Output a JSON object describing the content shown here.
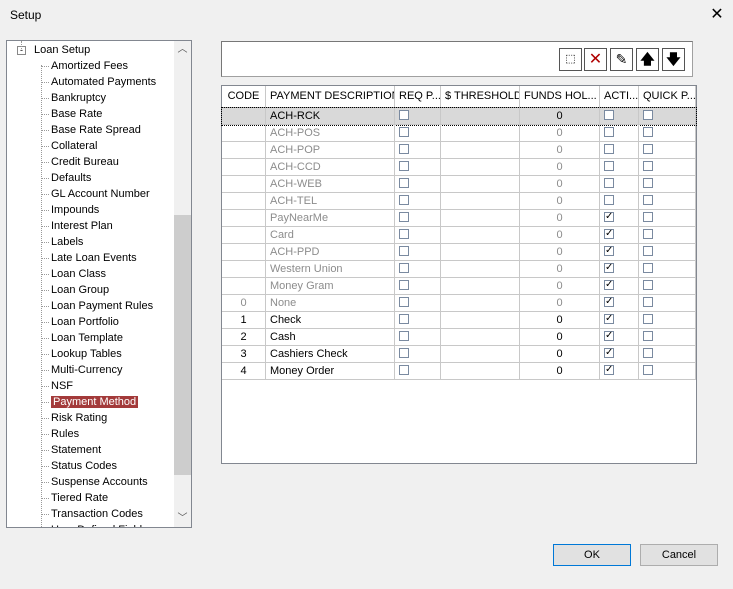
{
  "window": {
    "title": "Setup",
    "close_icon": "close-icon"
  },
  "tree": {
    "root": "Loan Setup",
    "selected": "Payment Method",
    "items": [
      "Amortized Fees",
      "Automated Payments",
      "Bankruptcy",
      "Base Rate",
      "Base Rate Spread",
      "Collateral",
      "Credit Bureau",
      "Defaults",
      "GL Account Number",
      "Impounds",
      "Interest Plan",
      "Labels",
      "Late Loan Events",
      "Loan Class",
      "Loan Group",
      "Loan Payment Rules",
      "Loan Portfolio",
      "Loan Template",
      "Lookup Tables",
      "Multi-Currency",
      "NSF",
      "Payment Method",
      "Risk Rating",
      "Rules",
      "Statement",
      "Status Codes",
      "Suspense Accounts",
      "Tiered Rate",
      "Transaction Codes",
      "User Defined Fields"
    ]
  },
  "toolbar": {
    "buttons": [
      "new-icon",
      "delete-icon",
      "edit-icon",
      "move-up-icon",
      "move-down-icon"
    ]
  },
  "grid": {
    "columns": [
      "CODE",
      "PAYMENT DESCRIPTION",
      "REQ P...",
      "$ THRESHOLD",
      "FUNDS HOL...",
      "ACTI...",
      "QUICK P..."
    ],
    "rows": [
      {
        "code": "",
        "desc": "ACH-RCK",
        "req": false,
        "threshold": "",
        "funds": "0",
        "active": false,
        "quick": false,
        "gray": false,
        "selected": true
      },
      {
        "code": "",
        "desc": "ACH-POS",
        "req": false,
        "threshold": "",
        "funds": "0",
        "active": false,
        "quick": false,
        "gray": true
      },
      {
        "code": "",
        "desc": "ACH-POP",
        "req": false,
        "threshold": "",
        "funds": "0",
        "active": false,
        "quick": false,
        "gray": true
      },
      {
        "code": "",
        "desc": "ACH-CCD",
        "req": false,
        "threshold": "",
        "funds": "0",
        "active": false,
        "quick": false,
        "gray": true
      },
      {
        "code": "",
        "desc": "ACH-WEB",
        "req": false,
        "threshold": "",
        "funds": "0",
        "active": false,
        "quick": false,
        "gray": true
      },
      {
        "code": "",
        "desc": "ACH-TEL",
        "req": false,
        "threshold": "",
        "funds": "0",
        "active": false,
        "quick": false,
        "gray": true
      },
      {
        "code": "",
        "desc": "PayNearMe",
        "req": false,
        "threshold": "",
        "funds": "0",
        "active": true,
        "quick": false,
        "gray": true
      },
      {
        "code": "",
        "desc": "Card",
        "req": false,
        "threshold": "",
        "funds": "0",
        "active": true,
        "quick": false,
        "gray": true
      },
      {
        "code": "",
        "desc": "ACH-PPD",
        "req": false,
        "threshold": "",
        "funds": "0",
        "active": true,
        "quick": false,
        "gray": true
      },
      {
        "code": "",
        "desc": "Western Union",
        "req": false,
        "threshold": "",
        "funds": "0",
        "active": true,
        "quick": false,
        "gray": true
      },
      {
        "code": "",
        "desc": "Money Gram",
        "req": false,
        "threshold": "",
        "funds": "0",
        "active": true,
        "quick": false,
        "gray": true
      },
      {
        "code": "0",
        "desc": "None",
        "req": false,
        "threshold": "",
        "funds": "0",
        "active": true,
        "quick": false,
        "gray": true
      },
      {
        "code": "1",
        "desc": "Check",
        "req": false,
        "threshold": "",
        "funds": "0",
        "active": true,
        "quick": false,
        "gray": false
      },
      {
        "code": "2",
        "desc": "Cash",
        "req": false,
        "threshold": "",
        "funds": "0",
        "active": true,
        "quick": false,
        "gray": false
      },
      {
        "code": "3",
        "desc": "Cashiers Check",
        "req": false,
        "threshold": "",
        "funds": "0",
        "active": true,
        "quick": false,
        "gray": false
      },
      {
        "code": "4",
        "desc": "Money Order",
        "req": false,
        "threshold": "",
        "funds": "0",
        "active": true,
        "quick": false,
        "gray": false
      }
    ]
  },
  "buttons": {
    "ok": "OK",
    "cancel": "Cancel"
  }
}
